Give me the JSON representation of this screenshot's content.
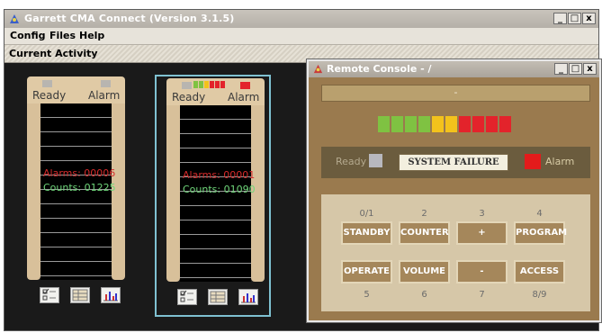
{
  "window": {
    "title": "Garrett CMA Connect (Version 3.1.5)"
  },
  "window_buttons": [
    "_",
    "□",
    "x"
  ],
  "menu": [
    "Config",
    "Files",
    "Help"
  ],
  "section_title": "Current Activity",
  "panels": [
    {
      "ready": "Ready",
      "alarm": "Alarm",
      "alarms_text": "Alarms: 00006",
      "counts_text": "Counts: 01225",
      "selected": false
    },
    {
      "ready": "Ready",
      "alarm": "Alarm",
      "alarms_text": "Alarms: 00001",
      "counts_text": "Counts: 01090",
      "selected": true
    }
  ],
  "panel_icons": [
    "checklist-icon",
    "ledger-icon",
    "chart-icon"
  ],
  "remote_console": {
    "title": "Remote Console - /",
    "display": "-",
    "ready_label": "Ready",
    "status_text": "SYSTEM FAILURE",
    "alarm_label": "Alarm",
    "keypad": {
      "top_numbers": [
        "0/1",
        "2",
        "3",
        "4"
      ],
      "row1": [
        "STANDBY",
        "COUNTER",
        "+",
        "PROGRAM"
      ],
      "row2": [
        "OPERATE",
        "VOLUME",
        "-",
        "ACCESS"
      ],
      "bottom_numbers": [
        "5",
        "6",
        "7",
        "8/9"
      ]
    }
  },
  "colors": {
    "led_green": "#7fc242",
    "led_yellow": "#f3c21c",
    "led_red": "#e3232b",
    "alarm_red": "#e31b1b"
  }
}
